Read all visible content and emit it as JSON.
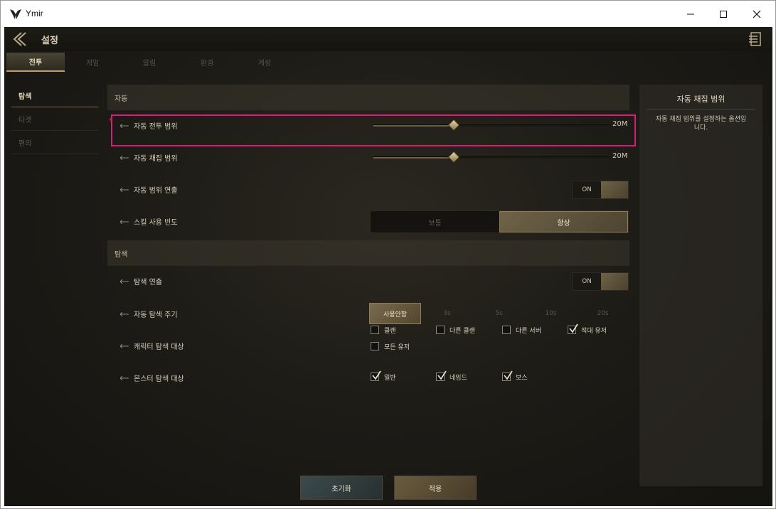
{
  "window": {
    "title": "Ymir"
  },
  "header": {
    "title": "설정"
  },
  "tabs": [
    {
      "label": "전투",
      "active": true
    },
    {
      "label": "게임",
      "active": false
    },
    {
      "label": "알림",
      "active": false
    },
    {
      "label": "환경",
      "active": false
    },
    {
      "label": "계정",
      "active": false
    }
  ],
  "sidebar": [
    {
      "label": "탐색",
      "active": true
    },
    {
      "label": "타겟",
      "active": false
    },
    {
      "label": "편의",
      "active": false
    }
  ],
  "auto_section": {
    "title": "자동",
    "combat_range": {
      "label": "자동 전투 범위",
      "value": "20M",
      "fill": 0.34
    },
    "gather_range": {
      "label": "자동 채집 범위",
      "value": "20M",
      "fill": 0.34
    },
    "range_effect": {
      "label": "자동 범위 연출",
      "state": "ON"
    },
    "skill_freq": {
      "label": "스킬 사용 빈도",
      "options": [
        "보통",
        "항상"
      ],
      "selected": "항상"
    }
  },
  "search_section": {
    "title": "탐색",
    "search_effect": {
      "label": "탐색 연출",
      "state": "ON"
    },
    "search_cycle": {
      "label": "자동 탐색 주기",
      "options": [
        "사용안함",
        "3s",
        "5s",
        "10s",
        "20s"
      ],
      "selected": "사용안함"
    },
    "char_target": {
      "label": "캐릭터 탐색 대상",
      "options": [
        {
          "label": "클랜",
          "checked": false
        },
        {
          "label": "다른 클랜",
          "checked": false
        },
        {
          "label": "다른 서버",
          "checked": false
        },
        {
          "label": "적대 유저",
          "checked": true
        },
        {
          "label": "모든 유저",
          "checked": false
        }
      ]
    },
    "monster_target": {
      "label": "몬스터 탐색 대상",
      "options": [
        {
          "label": "일반",
          "checked": true
        },
        {
          "label": "네임드",
          "checked": true
        },
        {
          "label": "보스",
          "checked": true
        }
      ]
    }
  },
  "help": {
    "title": "자동 채집 범위",
    "description": "자동 채집 범위를 설정하는 옵션입니다."
  },
  "buttons": {
    "reset": "초기화",
    "apply": "적용"
  },
  "colors": {
    "highlight": "#e0197a",
    "accent_gold": "#c4a15a"
  }
}
